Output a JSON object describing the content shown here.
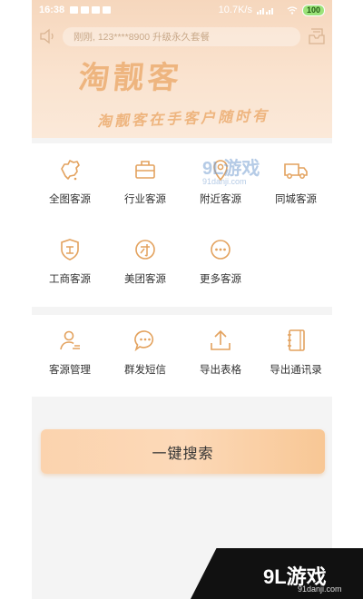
{
  "status_bar": {
    "time": "16:38",
    "network_speed": "10.7K/s",
    "battery": "100"
  },
  "notice": {
    "text": "刚刚, 123****8900  升级永久套餐"
  },
  "header": {
    "logo_text": "淘靓客",
    "slogan": "淘靓客在手客户随时有"
  },
  "grid1": [
    {
      "label": "全图客源",
      "icon": "china-map-icon"
    },
    {
      "label": "行业客源",
      "icon": "briefcase-icon"
    },
    {
      "label": "附近客源",
      "icon": "location-pin-icon"
    },
    {
      "label": "同城客源",
      "icon": "truck-icon"
    },
    {
      "label": "工商客源",
      "icon": "shield-badge-icon"
    },
    {
      "label": "美团客源",
      "icon": "meituan-icon"
    },
    {
      "label": "更多客源",
      "icon": "more-dots-icon"
    }
  ],
  "grid2": [
    {
      "label": "客源管理",
      "icon": "user-manage-icon"
    },
    {
      "label": "群发短信",
      "icon": "chat-bubble-icon"
    },
    {
      "label": "导出表格",
      "icon": "upload-icon"
    },
    {
      "label": "导出通讯录",
      "icon": "contacts-book-icon"
    }
  ],
  "search_button": {
    "label": "一键搜索"
  },
  "watermark": {
    "top": "9L游戏",
    "top_sub": "91danji.com",
    "bottom": "9L游戏",
    "bottom_sub": "91danji.com"
  },
  "colors": {
    "accent": "#eeb57f",
    "icon": "#e3a25e"
  }
}
